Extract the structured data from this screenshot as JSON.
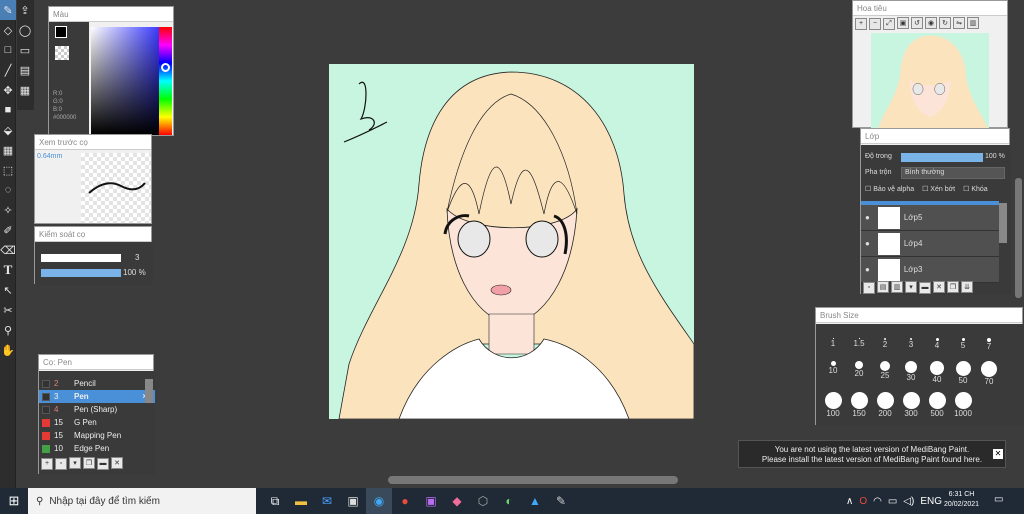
{
  "color_panel": {
    "title": "Màu",
    "r": "R:0",
    "g": "G:0",
    "b": "B:0",
    "hex": "#000000"
  },
  "brush_preview": {
    "title": "Xem trước cọ",
    "size": "0.64mm"
  },
  "brush_control": {
    "title": "Kiểm soát cọ",
    "size_value": "3",
    "opacity_value": "100 %"
  },
  "brush_list": {
    "title": "Cọ: Pen",
    "items": [
      {
        "size": "2",
        "name": "Pencil",
        "color": "#333333"
      },
      {
        "size": "3",
        "name": "Pen",
        "color": "#333333",
        "selected": true
      },
      {
        "size": "4",
        "name": "Pen (Sharp)",
        "color": "#333333"
      },
      {
        "size": "15",
        "name": "G Pen",
        "color": "#e53935"
      },
      {
        "size": "15",
        "name": "Mapping Pen",
        "color": "#e53935"
      },
      {
        "size": "10",
        "name": "Edge Pen",
        "color": "#43a047"
      }
    ]
  },
  "navigator": {
    "title": "Hoa tiêu"
  },
  "layers": {
    "title": "Lớp",
    "opacity_label": "Độ trong",
    "opacity_value": "100 %",
    "blend_label": "Pha trộn",
    "blend_value": "Bình thường",
    "protect_alpha": "Bảo vệ alpha",
    "clipping": "Xén bớt",
    "lock": "Khóa",
    "items": [
      "Lớp5",
      "Lớp4",
      "Lớp3"
    ]
  },
  "brush_size": {
    "title": "Brush Size",
    "row1": [
      "1",
      "1.5",
      "2",
      "3",
      "4",
      "5",
      "7"
    ],
    "row2": [
      "10",
      "20",
      "25",
      "30",
      "40",
      "50",
      "70"
    ],
    "row3": [
      "100",
      "150",
      "200",
      "300",
      "500",
      "1000"
    ]
  },
  "notice": {
    "line1": "You are not using the latest version of MediBang Paint.",
    "line2": "Please install the latest version of MediBang Paint found here."
  },
  "taskbar": {
    "search_placeholder": "Nhập tại đây để tìm kiếm",
    "time": "6:31 CH",
    "date": "20/02/2021"
  },
  "colors": {
    "canvas_bg": "#c8f5e0",
    "accent": "#4a90d9",
    "skin": "#fde4d8",
    "hair": "#fbe3bd"
  }
}
